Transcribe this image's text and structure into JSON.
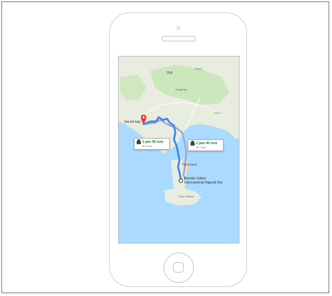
{
  "map": {
    "labels": {
      "bali": "Bali",
      "amed": "Amed",
      "singaraja": "Singaraja",
      "ubud": "Ubud",
      "denpasar": "Denpasar",
      "kuta_selatan": "Kuta Selatan"
    },
    "origin": {
      "name": "Bandar Udara Internasional Ngurah Rai"
    },
    "destination": {
      "name": "Secret bay"
    },
    "routes": [
      {
        "duration": "1 jam 45 mnt",
        "distance": "90,2 km",
        "selected": true
      },
      {
        "duration": "1 jam 40 mnt",
        "distance": "87,3 km",
        "selected": false
      }
    ],
    "colors": {
      "water": "#aadaff",
      "land": "#e8eddf",
      "park": "#c8e6b8",
      "route_primary": "#4285f4",
      "route_alt": "#9aa9c7",
      "marker": "#db4437",
      "duration_text": "#188038"
    }
  }
}
